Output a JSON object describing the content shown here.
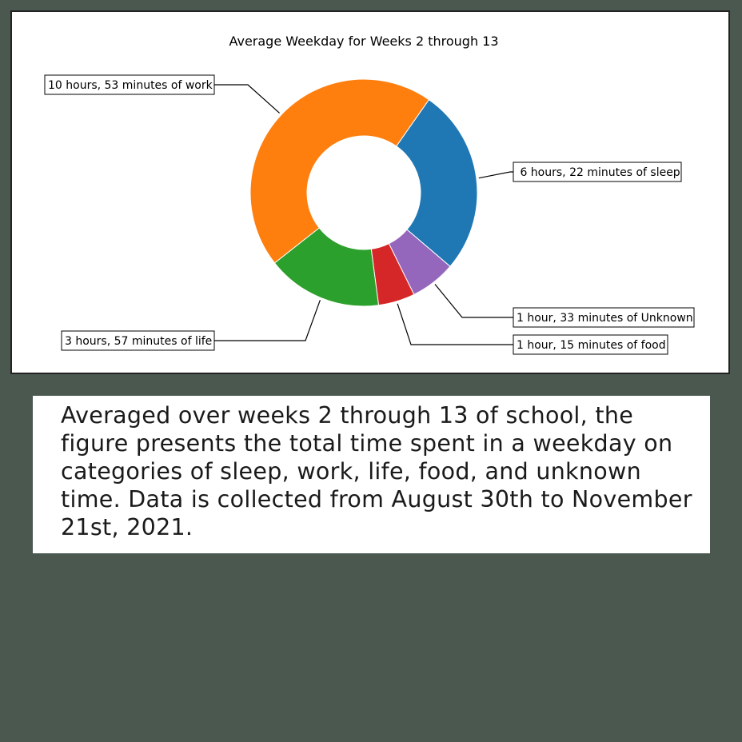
{
  "chart_data": {
    "type": "pie",
    "donut": true,
    "title": "Average Weekday for Weeks 2 through 13",
    "unit": "minutes",
    "slices": [
      {
        "name": "sleep",
        "value": 382,
        "label": " 6 hours, 22 minutes of sleep",
        "color": "#1f77b4"
      },
      {
        "name": "work",
        "value": 653,
        "label": "10 hours, 53 minutes of work",
        "color": "#ff7f0e"
      },
      {
        "name": "life",
        "value": 237,
        "label": "3 hours, 57 minutes of life",
        "color": "#2ca02c"
      },
      {
        "name": "food",
        "value": 75,
        "label": "1 hour, 15 minutes of food",
        "color": "#d62728"
      },
      {
        "name": "Unknown",
        "value": 93,
        "label": "1 hour, 33 minutes of Unknown",
        "color": "#9467bd"
      }
    ]
  },
  "caption": "Averaged over weeks 2 through 13 of school, the figure presents the total time spent in a weekday on categories of sleep, work, life, food, and unknown time.  Data is collected from August 30th to November 21st, 2021."
}
